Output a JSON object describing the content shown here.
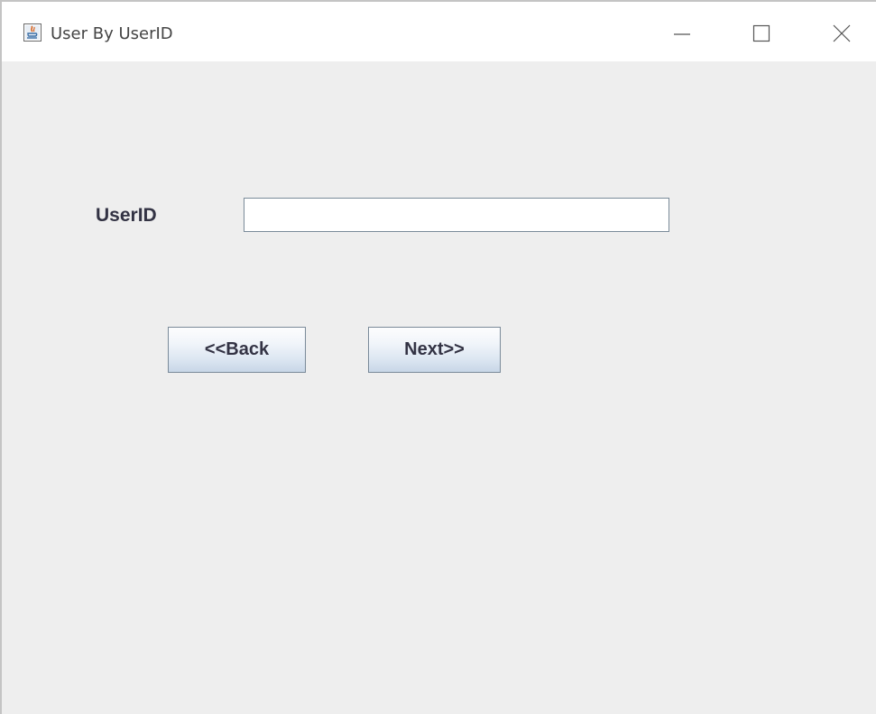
{
  "window": {
    "title": "User By UserID",
    "app_icon": "java-icon",
    "controls": {
      "minimize_icon": "minimize-icon",
      "maximize_icon": "maximize-icon",
      "close_icon": "close-icon"
    }
  },
  "form": {
    "userid_label": "UserID",
    "userid_value": "",
    "back_label": "<<Back",
    "next_label": "Next>>"
  },
  "colors": {
    "content_background": "#eeeeee",
    "titlebar_background": "#ffffff",
    "label_text": "#333344",
    "button_border": "#7a8a99"
  }
}
